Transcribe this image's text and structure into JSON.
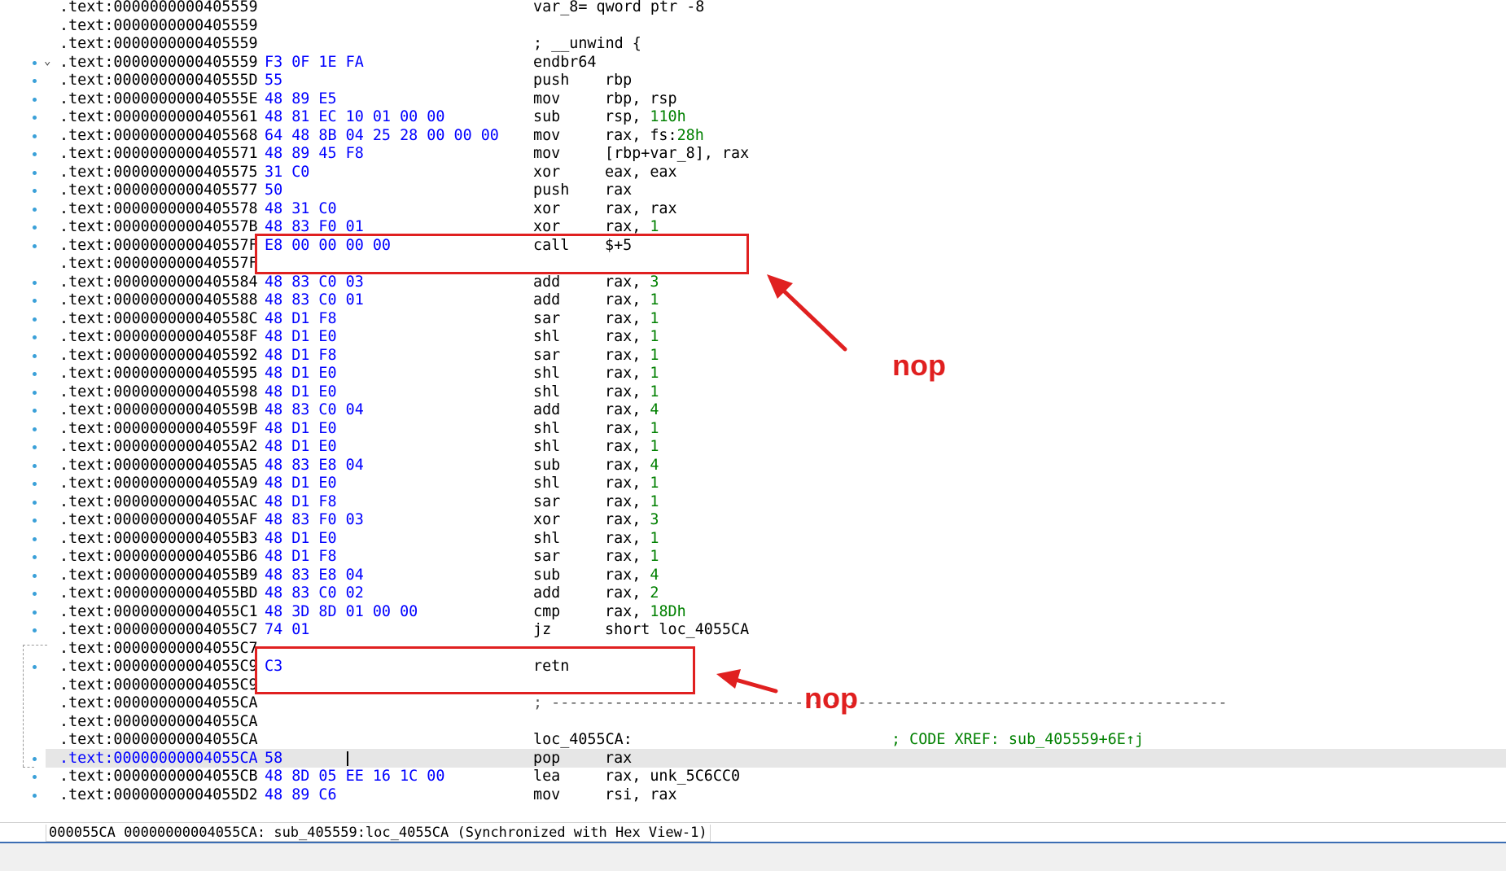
{
  "rows": [
    {
      "addr": ".text:0000000000405559",
      "bytes": "",
      "mnem": "var_8= qword ptr -8",
      "ops": "",
      "dot": false
    },
    {
      "addr": ".text:0000000000405559",
      "bytes": "",
      "mnem": "",
      "ops": "",
      "dot": false
    },
    {
      "addr": ".text:0000000000405559",
      "bytes": "",
      "mnem": "; __unwind {",
      "ops": "",
      "dot": false
    },
    {
      "addr": ".text:0000000000405559",
      "bytes": "F3 0F 1E FA",
      "mnem": "endbr64",
      "ops": "",
      "dot": true,
      "chev": true
    },
    {
      "addr": ".text:000000000040555D",
      "bytes": "55",
      "mnem": "push",
      "ops": "rbp",
      "dot": true
    },
    {
      "addr": ".text:000000000040555E",
      "bytes": "48 89 E5",
      "mnem": "mov",
      "ops": "rbp, rsp",
      "dot": true
    },
    {
      "addr": ".text:0000000000405561",
      "bytes": "48 81 EC 10 01 00 00",
      "mnem": "sub",
      "ops": "rsp, ",
      "num": "110h",
      "dot": true
    },
    {
      "addr": ".text:0000000000405568",
      "bytes": "64 48 8B 04 25 28 00 00 00",
      "mnem": "mov",
      "ops": "rax, fs:",
      "num": "28h",
      "dot": true
    },
    {
      "addr": ".text:0000000000405571",
      "bytes": "48 89 45 F8",
      "mnem": "mov",
      "ops": "[rbp+var_8], rax",
      "dot": true
    },
    {
      "addr": ".text:0000000000405575",
      "bytes": "31 C0",
      "mnem": "xor",
      "ops": "eax, eax",
      "dot": true
    },
    {
      "addr": ".text:0000000000405577",
      "bytes": "50",
      "mnem": "push",
      "ops": "rax",
      "dot": true
    },
    {
      "addr": ".text:0000000000405578",
      "bytes": "48 31 C0",
      "mnem": "xor",
      "ops": "rax, rax",
      "dot": true
    },
    {
      "addr": ".text:000000000040557B",
      "bytes": "48 83 F0 01",
      "mnem": "xor",
      "ops": "rax, ",
      "num": "1",
      "dot": true
    },
    {
      "addr": ".text:000000000040557F",
      "bytes": "E8 00 00 00 00",
      "mnem": "call",
      "ops": "$+5",
      "dot": true
    },
    {
      "addr": ".text:000000000040557F",
      "bytes": "",
      "mnem": "",
      "ops": "",
      "dot": false
    },
    {
      "addr": ".text:0000000000405584",
      "bytes": "48 83 C0 03",
      "mnem": "add",
      "ops": "rax, ",
      "num": "3",
      "dot": true
    },
    {
      "addr": ".text:0000000000405588",
      "bytes": "48 83 C0 01",
      "mnem": "add",
      "ops": "rax, ",
      "num": "1",
      "dot": true
    },
    {
      "addr": ".text:000000000040558C",
      "bytes": "48 D1 F8",
      "mnem": "sar",
      "ops": "rax, ",
      "num": "1",
      "dot": true
    },
    {
      "addr": ".text:000000000040558F",
      "bytes": "48 D1 E0",
      "mnem": "shl",
      "ops": "rax, ",
      "num": "1",
      "dot": true
    },
    {
      "addr": ".text:0000000000405592",
      "bytes": "48 D1 F8",
      "mnem": "sar",
      "ops": "rax, ",
      "num": "1",
      "dot": true
    },
    {
      "addr": ".text:0000000000405595",
      "bytes": "48 D1 E0",
      "mnem": "shl",
      "ops": "rax, ",
      "num": "1",
      "dot": true
    },
    {
      "addr": ".text:0000000000405598",
      "bytes": "48 D1 E0",
      "mnem": "shl",
      "ops": "rax, ",
      "num": "1",
      "dot": true
    },
    {
      "addr": ".text:000000000040559B",
      "bytes": "48 83 C0 04",
      "mnem": "add",
      "ops": "rax, ",
      "num": "4",
      "dot": true
    },
    {
      "addr": ".text:000000000040559F",
      "bytes": "48 D1 E0",
      "mnem": "shl",
      "ops": "rax, ",
      "num": "1",
      "dot": true
    },
    {
      "addr": ".text:00000000004055A2",
      "bytes": "48 D1 E0",
      "mnem": "shl",
      "ops": "rax, ",
      "num": "1",
      "dot": true
    },
    {
      "addr": ".text:00000000004055A5",
      "bytes": "48 83 E8 04",
      "mnem": "sub",
      "ops": "rax, ",
      "num": "4",
      "dot": true
    },
    {
      "addr": ".text:00000000004055A9",
      "bytes": "48 D1 E0",
      "mnem": "shl",
      "ops": "rax, ",
      "num": "1",
      "dot": true
    },
    {
      "addr": ".text:00000000004055AC",
      "bytes": "48 D1 F8",
      "mnem": "sar",
      "ops": "rax, ",
      "num": "1",
      "dot": true
    },
    {
      "addr": ".text:00000000004055AF",
      "bytes": "48 83 F0 03",
      "mnem": "xor",
      "ops": "rax, ",
      "num": "3",
      "dot": true
    },
    {
      "addr": ".text:00000000004055B3",
      "bytes": "48 D1 E0",
      "mnem": "shl",
      "ops": "rax, ",
      "num": "1",
      "dot": true
    },
    {
      "addr": ".text:00000000004055B6",
      "bytes": "48 D1 F8",
      "mnem": "sar",
      "ops": "rax, ",
      "num": "1",
      "dot": true
    },
    {
      "addr": ".text:00000000004055B9",
      "bytes": "48 83 E8 04",
      "mnem": "sub",
      "ops": "rax, ",
      "num": "4",
      "dot": true
    },
    {
      "addr": ".text:00000000004055BD",
      "bytes": "48 83 C0 02",
      "mnem": "add",
      "ops": "rax, ",
      "num": "2",
      "dot": true
    },
    {
      "addr": ".text:00000000004055C1",
      "bytes": "48 3D 8D 01 00 00",
      "mnem": "cmp",
      "ops": "rax, ",
      "num": "18Dh",
      "dot": true
    },
    {
      "addr": ".text:00000000004055C7",
      "bytes": "74 01",
      "mnem": "jz",
      "ops": "short loc_4055CA",
      "dot": true
    },
    {
      "addr": ".text:00000000004055C7",
      "bytes": "",
      "mnem": "",
      "ops": "",
      "dot": false
    },
    {
      "addr": ".text:00000000004055C9",
      "bytes": "C3",
      "mnem": "retn",
      "ops": "",
      "dot": true
    },
    {
      "addr": ".text:00000000004055C9",
      "bytes": "",
      "mnem": "",
      "ops": "",
      "dot": false
    },
    {
      "addr": ".text:00000000004055CA",
      "bytes": "",
      "mnem": "",
      "ops": "",
      "dot": false,
      "separator": "; ---------------------------------------------------------------------------"
    },
    {
      "addr": ".text:00000000004055CA",
      "bytes": "",
      "mnem": "",
      "ops": "",
      "dot": false
    },
    {
      "addr": ".text:00000000004055CA",
      "bytes": "",
      "mnem": "",
      "ops": "",
      "dot": false,
      "label": "loc_4055CA:",
      "comment": "; CODE XREF: sub_405559+6E↑j"
    },
    {
      "addr": ".text:00000000004055CA",
      "bytes": "58",
      "mnem": "pop",
      "ops": "rax",
      "dot": true,
      "current": true
    },
    {
      "addr": ".text:00000000004055CB",
      "bytes": "48 8D 05 EE 16 1C 00",
      "mnem": "lea",
      "ops": "rax, unk_5C6CC0",
      "dot": true
    },
    {
      "addr": ".text:00000000004055D2",
      "bytes": "48 89 C6",
      "mnem": "mov",
      "ops": "rsi, rax",
      "dot": true
    }
  ],
  "annotations": {
    "nop_top": "nop",
    "nop_bottom": "nop",
    "color": "#e02020"
  },
  "status": {
    "text": "000055CA 00000000004055CA: sub_405559:loc_4055CA (Synchronized with Hex View-1)"
  },
  "colors": {
    "address": "#000000",
    "bytes": "#0000ff",
    "numbers": "#008000",
    "comments": "#008000",
    "highlight": "#e6e6e6",
    "gutter_dot": "#3aa0d8"
  }
}
